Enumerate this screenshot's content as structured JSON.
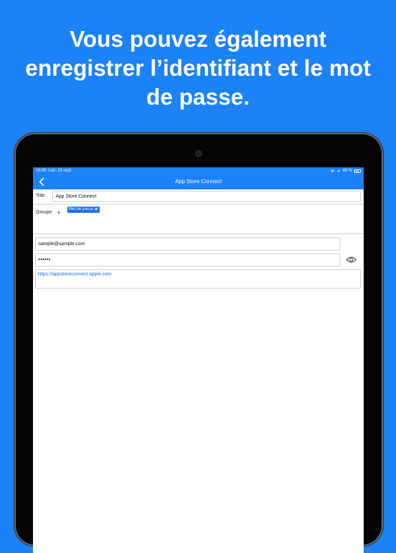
{
  "headline": {
    "line1": "Vous pouvez également",
    "line2": "enregistrer l’identifiant et le mot",
    "line3": "de passe."
  },
  "statusbar": {
    "time": "16:00",
    "date": "Lun. 23 sept.",
    "battery": "66 %"
  },
  "navbar": {
    "title": "App Store Connect"
  },
  "form": {
    "title_label": "Title",
    "title_value": "App Store Connect",
    "group_label": "Groupe",
    "group_add": "+",
    "group_tag": "Mot de passe",
    "group_tag_remove": "✕",
    "email_value": "sample@sample.com",
    "password_value": "••••••",
    "url_value": "https://appstoreconnect.apple.com"
  },
  "colors": {
    "accent": "#1b82f7",
    "tag": "#1b6fe8"
  }
}
